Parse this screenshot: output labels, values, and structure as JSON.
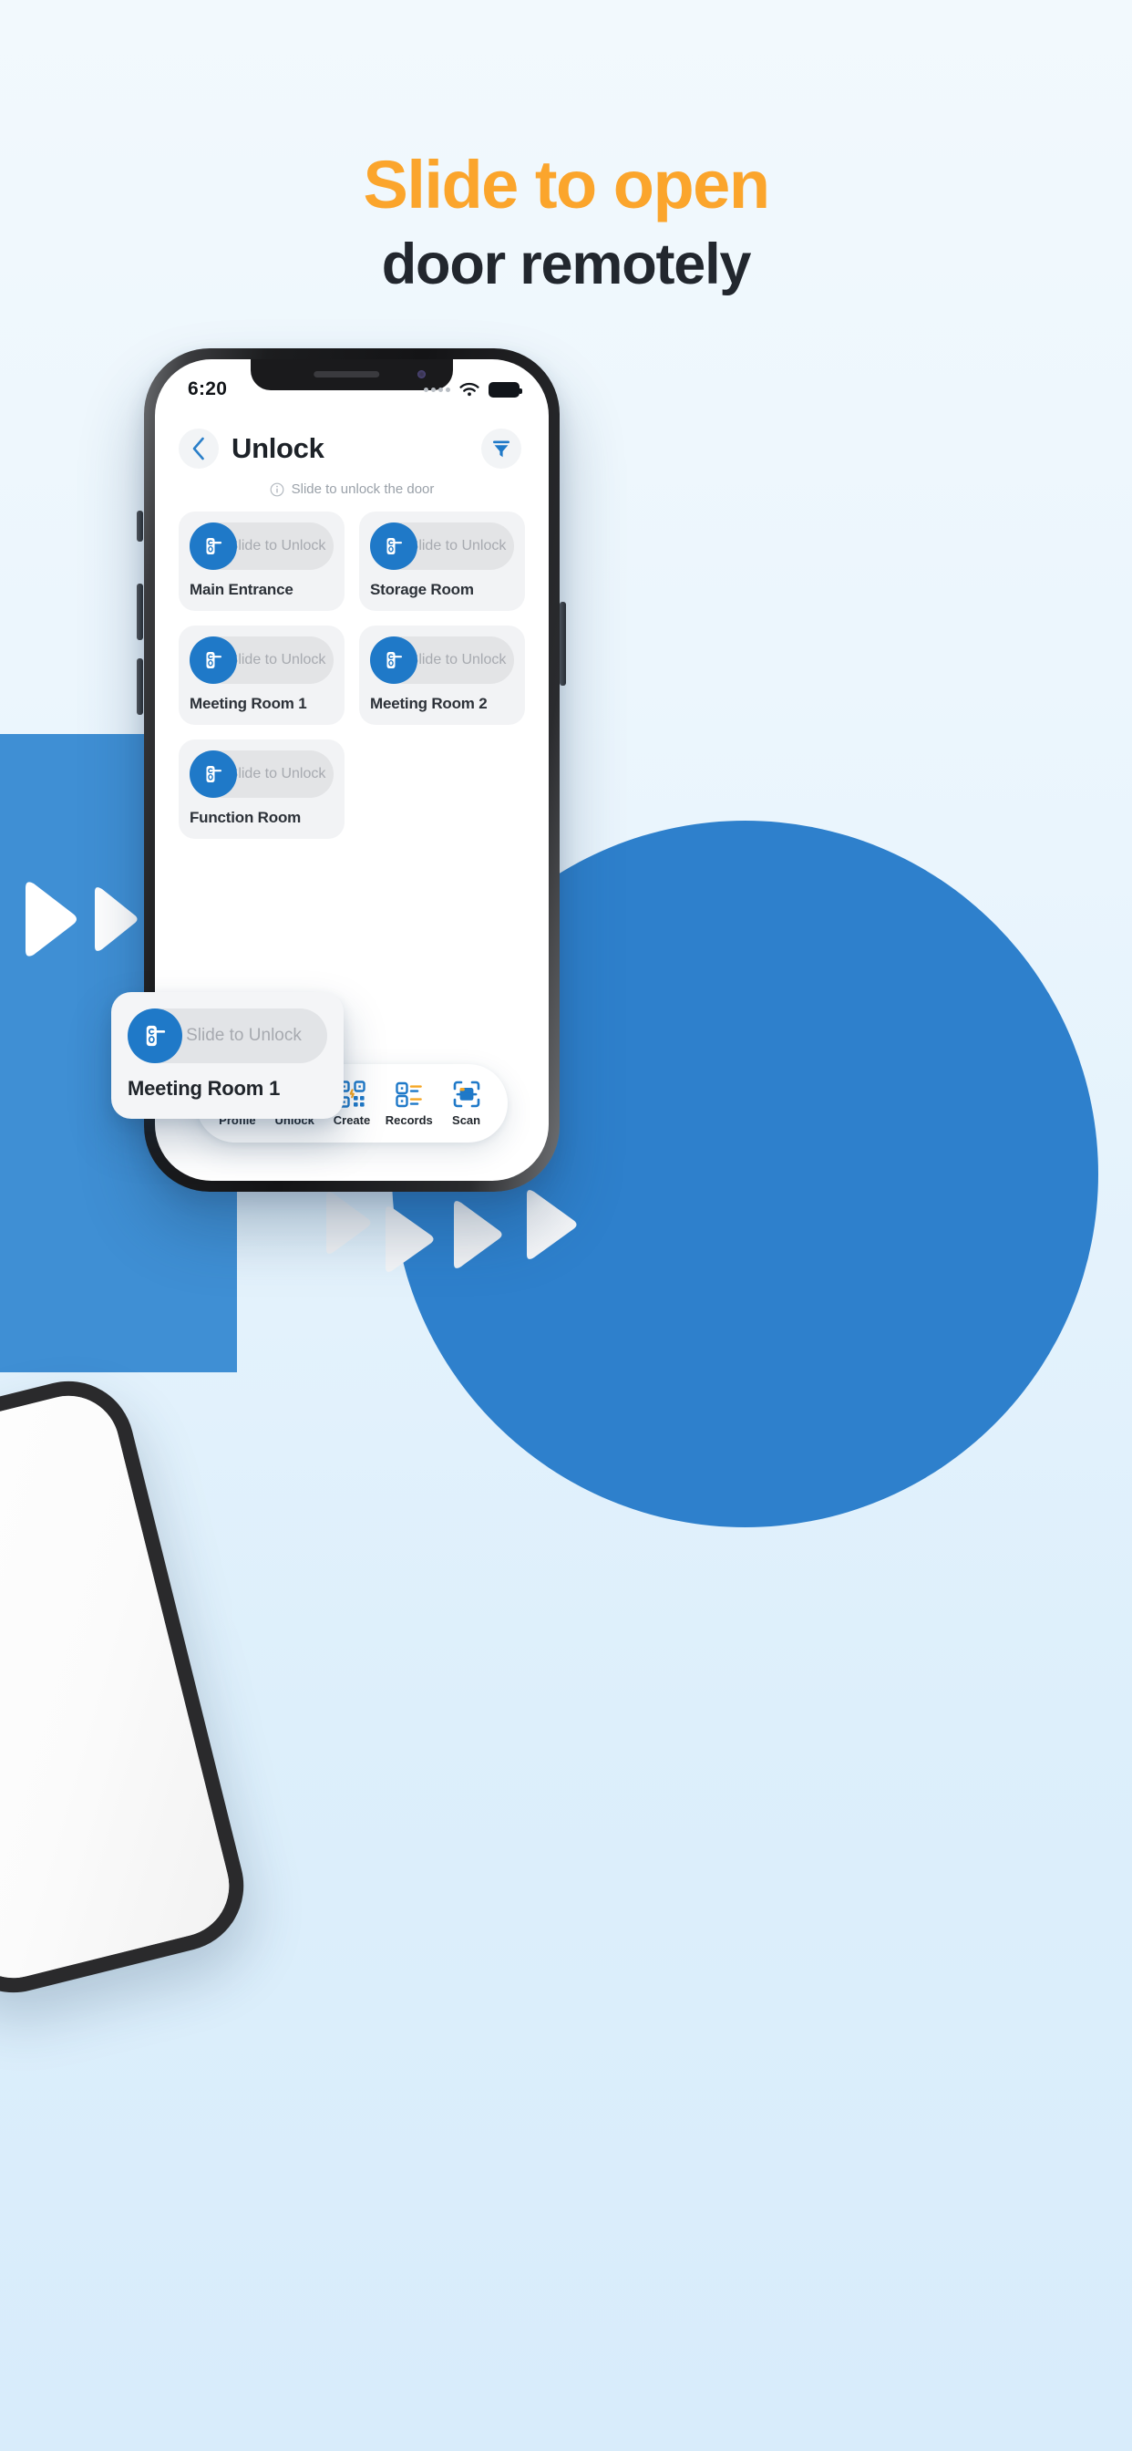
{
  "promo": {
    "headline_line1": "Slide to open",
    "headline_line2": "door remotely",
    "accent_color": "#fba52c",
    "dark_color": "#22272e"
  },
  "background": {
    "panel_color": "#3f8fd4",
    "circle_color": "#2e80cc",
    "page_gradient_top": "#f2f9fd",
    "page_gradient_bottom": "#d8ecfb"
  },
  "phone": {
    "status_bar": {
      "time": "6:20",
      "signal_icon": "signal-dots-icon",
      "wifi_icon": "wifi-icon",
      "battery_icon": "battery-full-icon"
    },
    "header": {
      "back_icon": "chevron-left-icon",
      "title": "Unlock",
      "filter_icon": "filter-funnel-icon"
    },
    "hint": {
      "icon": "info-circle-icon",
      "text": "Slide to unlock the door"
    },
    "doors": [
      {
        "name": "Main Entrance",
        "slide_label": "Slide to Unlock",
        "icon": "door-handle-icon"
      },
      {
        "name": "Storage Room",
        "slide_label": "Slide to Unlock",
        "icon": "door-handle-icon"
      },
      {
        "name": "Meeting Room 1",
        "slide_label": "Slide to Unlock",
        "icon": "door-handle-icon"
      },
      {
        "name": "Meeting Room 2",
        "slide_label": "Slide to Unlock",
        "icon": "door-handle-icon"
      },
      {
        "name": "Function Room",
        "slide_label": "Slide to Unlock",
        "icon": "door-handle-icon"
      }
    ],
    "magnified_card": {
      "name": "Meeting Room 1",
      "slide_label": "Slide to Unlock",
      "icon": "door-handle-icon"
    },
    "bottom_nav": [
      {
        "label": "Profile",
        "icon": "profile-avatar-icon"
      },
      {
        "label": "Unlock",
        "icon": "padlock-icon"
      },
      {
        "label": "Create",
        "icon": "qr-code-icon"
      },
      {
        "label": "Records",
        "icon": "records-list-icon"
      },
      {
        "label": "Scan",
        "icon": "scan-frame-icon"
      }
    ]
  },
  "decor": {
    "arrow_icon": "play-arrow-icon",
    "arrow_count_blue_panel": 2,
    "arrow_count_white": 4
  }
}
